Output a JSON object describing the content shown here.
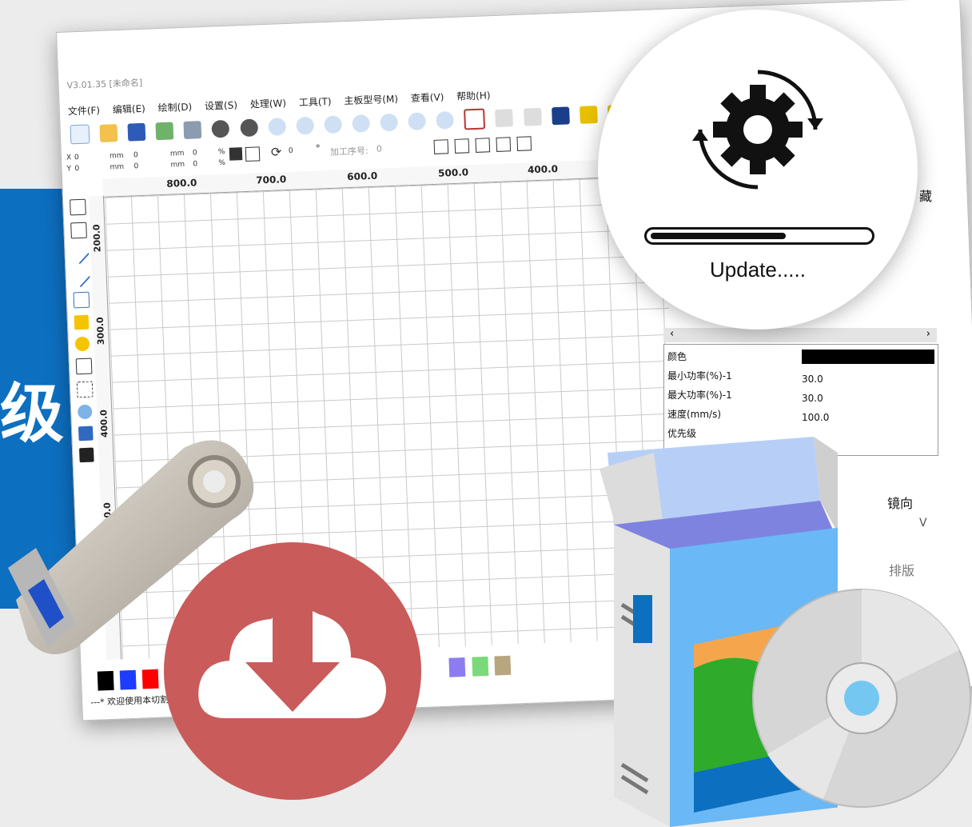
{
  "banner": {
    "char": "级",
    "color": "#0d6fc0"
  },
  "window": {
    "title": "V3.01.35 [未命名]",
    "menu": [
      "文件(F)",
      "编辑(E)",
      "绘制(D)",
      "设置(S)",
      "处理(W)",
      "工具(T)",
      "主板型号(M)",
      "查看(V)",
      "帮助(H)"
    ],
    "coord": {
      "x_label": "X",
      "x_value": "0",
      "y_label": "Y",
      "y_value": "0",
      "unit_mm": "mm",
      "w_value": "0",
      "h_value": "0",
      "pct_1": "0",
      "pct_2": "0",
      "pct_unit": "%",
      "rotate_value": "0",
      "degree": "°",
      "seq_label": "加工序号:",
      "seq_value": "0"
    },
    "ruler_top": [
      "800.0",
      "700.0",
      "600.0",
      "500.0",
      "400.0"
    ],
    "ruler_left": [
      "200.0",
      "300.0",
      "400.0",
      "500.0"
    ],
    "palette": [
      "#000000",
      "#1e3cff",
      "#ff0000",
      "#00cc00",
      "#ff8a80",
      "#8d7cf0",
      "#7ad97a",
      "#b7a67e"
    ],
    "status": "---* 欢迎使用本切割雕刻",
    "panel_header_fragment": "藏",
    "layer_props": [
      {
        "label": "颜色",
        "value": ""
      },
      {
        "label": "最小功率(%)-1",
        "value": "30.0"
      },
      {
        "label": "最大功率(%)-1",
        "value": "30.0"
      },
      {
        "label": "速度(mm/s)",
        "value": "100.0"
      },
      {
        "label": "优先级",
        "value": ""
      }
    ],
    "layer_color": "#000000",
    "fragment_direction": "镜向",
    "fragment_v": "V",
    "fragment_layout": "排版"
  },
  "update": {
    "text": "Update.....",
    "progress": 0.62
  },
  "download": {
    "icon": "cloud-download-icon",
    "color": "#c95b5a"
  },
  "usb": {
    "icon": "usb-drive-icon"
  },
  "software_box": {
    "icon": "software-box-icon"
  },
  "disc": {
    "icon": "cd-disc-icon"
  }
}
